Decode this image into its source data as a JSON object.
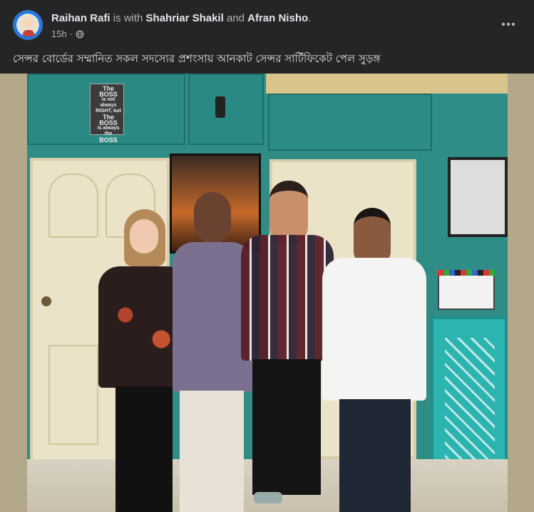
{
  "post": {
    "author": "Raihan Rafi",
    "with_text": "is with",
    "tagged_1": "Shahriar Shakil",
    "and_text": "and",
    "tagged_2": "Afran Nisho",
    "period": ".",
    "timestamp": "15h",
    "dot": "·",
    "text": "সেন্সর বোর্ডের সম্মানিত সকল সদস্যের প্রশংসায় আনকাট সেন্সর সার্টিফিকেট পেল সুড়ঙ্গ"
  },
  "photo": {
    "sign_lines": [
      "The BOSS",
      "is not always",
      "RIGHT, but",
      "The BOSS",
      "is always the",
      "BOSS"
    ]
  },
  "icons": {
    "more": "more-horizontal-icon",
    "audience": "globe-icon"
  },
  "colors": {
    "background": "#242526",
    "primary_text": "#e4e6eb",
    "secondary_text": "#b0b3b8",
    "wall": "#2f8d86"
  }
}
